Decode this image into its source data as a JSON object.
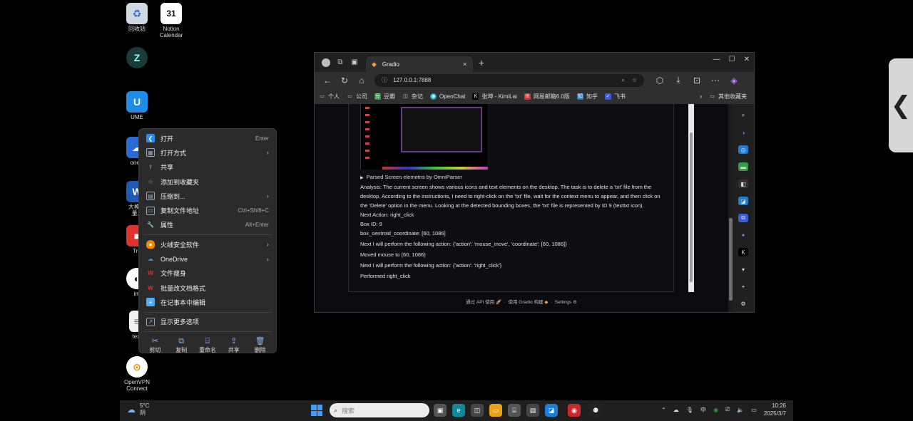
{
  "desktop": {
    "icons": [
      {
        "label": "回收站",
        "glyph": "♻"
      },
      {
        "label": "Notion Calendar",
        "glyph": "31"
      },
      {
        "label": "",
        "glyph": "Z"
      },
      {
        "label": "UME",
        "glyph": "U"
      },
      {
        "label": "oneD",
        "glyph": "☁"
      },
      {
        "label": "大模型\n量.d",
        "glyph": "W"
      },
      {
        "label": "Tra",
        "glyph": "■"
      },
      {
        "label": "im",
        "glyph": "◐"
      },
      {
        "label": "text",
        "glyph": "≡"
      },
      {
        "label": "OpenVPN Connect",
        "glyph": "⊙"
      }
    ]
  },
  "context_menu": {
    "items": [
      {
        "label": "打开",
        "shortcut": "Enter",
        "icon": "vscode-icon",
        "color": "#2d8cf0",
        "arrow": false
      },
      {
        "label": "打开方式",
        "shortcut": "",
        "icon": "open-with-icon",
        "color": "#9ab",
        "arrow": true
      },
      {
        "label": "共享",
        "shortcut": "",
        "icon": "share-icon",
        "color": "#9ab",
        "arrow": false
      },
      {
        "label": "添加到收藏夹",
        "shortcut": "",
        "icon": "star-icon",
        "color": "#9ab",
        "arrow": false
      },
      {
        "label": "压缩到...",
        "shortcut": "",
        "icon": "zip-icon",
        "color": "#9ab",
        "arrow": true
      },
      {
        "label": "复制文件地址",
        "shortcut": "Ctrl+Shift+C",
        "icon": "copy-path-icon",
        "color": "#9ab",
        "arrow": false
      },
      {
        "label": "属性",
        "shortcut": "Alt+Enter",
        "icon": "wrench-icon",
        "color": "#9ab",
        "arrow": false
      }
    ],
    "items2": [
      {
        "label": "火绒安全软件",
        "icon": "huorong-icon",
        "color": "#f08c00",
        "arrow": true
      },
      {
        "label": "OneDrive",
        "icon": "onedrive-icon",
        "color": "#3a8dde",
        "arrow": true
      },
      {
        "label": "文件瘦身",
        "icon": "wps-icon",
        "color": "#e03131",
        "arrow": false
      },
      {
        "label": "批量改文档格式",
        "icon": "wps-icon",
        "color": "#e03131",
        "arrow": false
      },
      {
        "label": "在记事本中编辑",
        "icon": "notepad-icon",
        "color": "#4dabf7",
        "arrow": false
      }
    ],
    "more": "显示更多选项",
    "actions": [
      {
        "label": "剪切",
        "glyph": "✂",
        "name": "cut-icon"
      },
      {
        "label": "复制",
        "glyph": "⧉",
        "name": "copy-icon"
      },
      {
        "label": "重命名",
        "glyph": "⌸",
        "name": "rename-icon"
      },
      {
        "label": "共享",
        "glyph": "⇪",
        "name": "share-icon"
      },
      {
        "label": "删除",
        "glyph": "🗑",
        "name": "delete-icon"
      }
    ]
  },
  "browser": {
    "tab_title": "Gradio",
    "url": "127.0.0.1:7888",
    "bookmarks": [
      {
        "label": "个人",
        "color": "#ccc",
        "glyph": "▭"
      },
      {
        "label": "公司",
        "color": "#ccc",
        "glyph": "▭"
      },
      {
        "label": "豆瓣",
        "color": "#2f9e44",
        "glyph": "豆"
      },
      {
        "label": "杂记",
        "color": "#ccc",
        "glyph": "◫"
      },
      {
        "label": "OpenChat",
        "color": "#15aabf",
        "glyph": "◉"
      },
      {
        "label": "张坤 - KimiLai",
        "color": "#fff",
        "glyph": "K"
      },
      {
        "label": "网易邮箱6.0版",
        "color": "#e03131",
        "glyph": "✉"
      },
      {
        "label": "知乎",
        "color": "#1c7ed6",
        "glyph": "知"
      },
      {
        "label": "飞书",
        "color": "#3b5bdb",
        "glyph": "✓"
      }
    ],
    "other_bookmarks": "其他收藏夹",
    "summary": "Parsed Screen elemetns by OmniParser",
    "output_lines": [
      "Analysis: The current screen shows various icons and text elements on the desktop. The task is to delete a 'txt' file from the desktop. According to the instructions, I need to right-click on the 'txt' file, wait for the context menu to appear, and then click on the 'Delete' option in the menu. Looking at the detected bounding boxes, the 'txt' file is represented by ID 9 (texttxt icon).",
      "Next Action: right_click",
      "Box ID: 9",
      "box_centroid_coordinate: [60, 1086]",
      "Next I will perform the following action: {'action': 'mouse_move', 'coordinate': [60, 1086]}",
      "Moved mouse to (60, 1086)",
      "Next I will perform the following action: {'action': 'right_click'}",
      "Performed right_click"
    ],
    "footer": {
      "api": "通过 API 使用",
      "built": "使用 Gradio 构建",
      "settings": "Settings"
    }
  },
  "taskbar": {
    "weather_temp": "5°C",
    "weather_desc": "阴",
    "search_placeholder": "搜索",
    "ime": "中",
    "time": "10:26",
    "date": "2025/3/7"
  }
}
